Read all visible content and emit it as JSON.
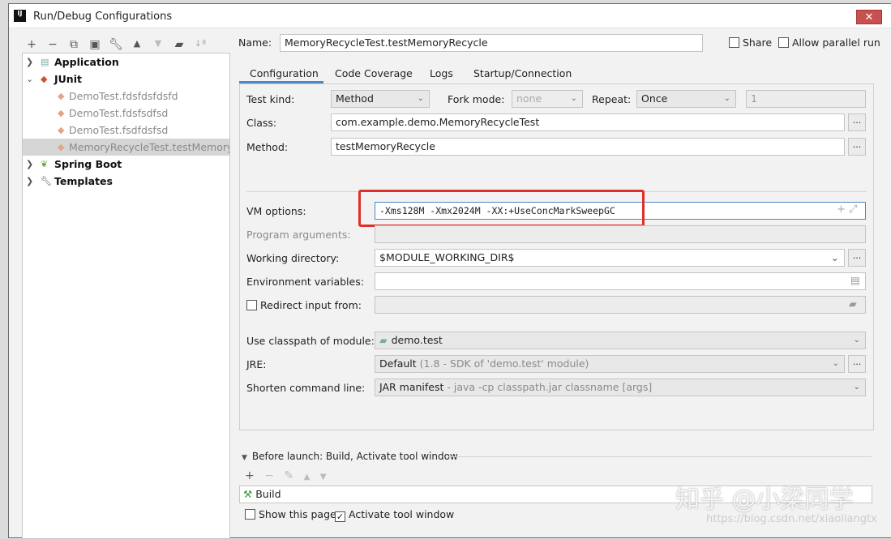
{
  "window": {
    "title": "Run/Debug Configurations",
    "logo": "IJ",
    "close": "✕"
  },
  "toolbar": {
    "icons": [
      "add-icon",
      "remove-icon",
      "copy-icon",
      "save-icon",
      "wrench-icon",
      "move-up-icon",
      "move-down-icon",
      "new-folder-icon",
      "sort-icon"
    ]
  },
  "tree": {
    "items": [
      {
        "label": "Application",
        "type": "group",
        "expanded": false
      },
      {
        "label": "JUnit",
        "type": "group",
        "expanded": true
      },
      {
        "label": "DemoTest.fdsfdsfdsfd",
        "type": "child"
      },
      {
        "label": "DemoTest.fdsfsdfsd",
        "type": "child"
      },
      {
        "label": "DemoTest.fsdfdsfsd",
        "type": "child"
      },
      {
        "label": "MemoryRecycleTest.testMemoryRecycle",
        "type": "child",
        "selected": true
      },
      {
        "label": "Spring Boot",
        "type": "group",
        "expanded": false
      },
      {
        "label": "Templates",
        "type": "group",
        "expanded": false
      }
    ]
  },
  "name": {
    "label": "Name:",
    "value": "MemoryRecycleTest.testMemoryRecycle",
    "share": "Share",
    "allow_parallel": "Allow parallel run"
  },
  "tabs": [
    "Configuration",
    "Code Coverage",
    "Logs",
    "Startup/Connection"
  ],
  "config": {
    "test_kind": {
      "label": "Test kind:",
      "value": "Method"
    },
    "fork_mode": {
      "label": "Fork mode:",
      "value": "none"
    },
    "repeat": {
      "label": "Repeat:",
      "value": "Once",
      "count": "1"
    },
    "class": {
      "label": "Class:",
      "value": "com.example.demo.MemoryRecycleTest"
    },
    "method": {
      "label": "Method:",
      "value": "testMemoryRecycle"
    },
    "vm_options": {
      "label": "VM options:",
      "value": "-Xms128M -Xmx2024M -XX:+UseConcMarkSweepGC"
    },
    "program_args": {
      "label": "Program arguments:",
      "value": ""
    },
    "working_dir": {
      "label": "Working directory:",
      "value": "$MODULE_WORKING_DIR$"
    },
    "env_vars": {
      "label": "Environment variables:",
      "value": ""
    },
    "redirect": {
      "label": "Redirect input from:",
      "value": ""
    },
    "classpath": {
      "label": "Use classpath of module:",
      "value": "demo.test"
    },
    "jre": {
      "label": "JRE:",
      "value": "Default",
      "hint": "(1.8 - SDK of 'demo.test' module)"
    },
    "shorten": {
      "label": "Shorten command line:",
      "value": "JAR manifest",
      "hint": "- java -cp classpath.jar classname [args]"
    }
  },
  "before_launch": {
    "title": "Before launch: Build, Activate tool window",
    "items": [
      "Build"
    ],
    "show_page": "Show this page",
    "activate_tool": "Activate tool window"
  },
  "watermark": {
    "text": "知乎 @小梁同学",
    "url": "https://blog.csdn.net/xiaoliangtx"
  },
  "colors": {
    "highlight": "#e0302a",
    "tab_accent": "#4a88c7"
  }
}
